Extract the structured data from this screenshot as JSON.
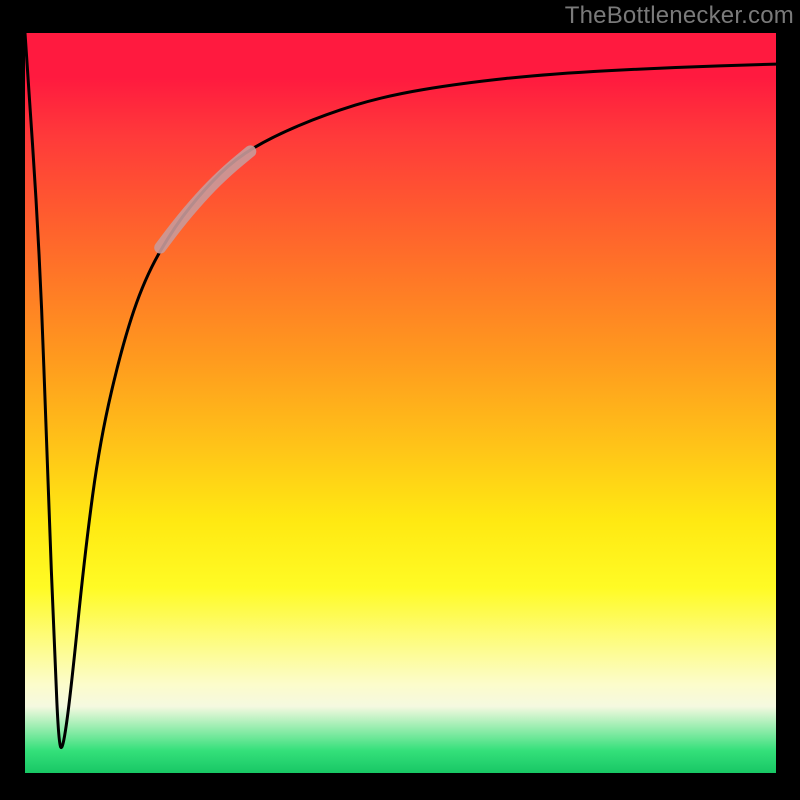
{
  "watermark": {
    "text": "TheBottlenecker.com"
  },
  "chart_data": {
    "type": "line",
    "title": "",
    "xlabel": "",
    "ylabel": "",
    "xlim": [
      0,
      100
    ],
    "ylim": [
      0,
      100
    ],
    "grid": false,
    "series": [
      {
        "name": "curve",
        "color": "#000000",
        "x": [
          0,
          2,
          3,
          4,
          4.5,
          5,
          6,
          8,
          10,
          13,
          16,
          20,
          24,
          28,
          33,
          40,
          48,
          58,
          70,
          85,
          100
        ],
        "y": [
          100,
          70,
          40,
          15,
          4,
          3,
          10,
          30,
          45,
          58,
          67,
          74,
          79,
          83,
          86,
          89,
          91.5,
          93.2,
          94.5,
          95.3,
          95.8
        ]
      },
      {
        "name": "highlight",
        "color": "#c99a9a",
        "x": [
          18,
          21,
          24,
          27,
          30
        ],
        "y": [
          71,
          75,
          78.5,
          81.5,
          84
        ]
      }
    ],
    "gradient_stops": [
      {
        "pos": 0,
        "color": "#ff1a3f"
      },
      {
        "pos": 14,
        "color": "#ff3a3a"
      },
      {
        "pos": 34,
        "color": "#ff7a26"
      },
      {
        "pos": 56,
        "color": "#ffc418"
      },
      {
        "pos": 75,
        "color": "#fffb25"
      },
      {
        "pos": 90,
        "color": "#f5f9e0"
      },
      {
        "pos": 100,
        "color": "#18c765"
      }
    ]
  }
}
